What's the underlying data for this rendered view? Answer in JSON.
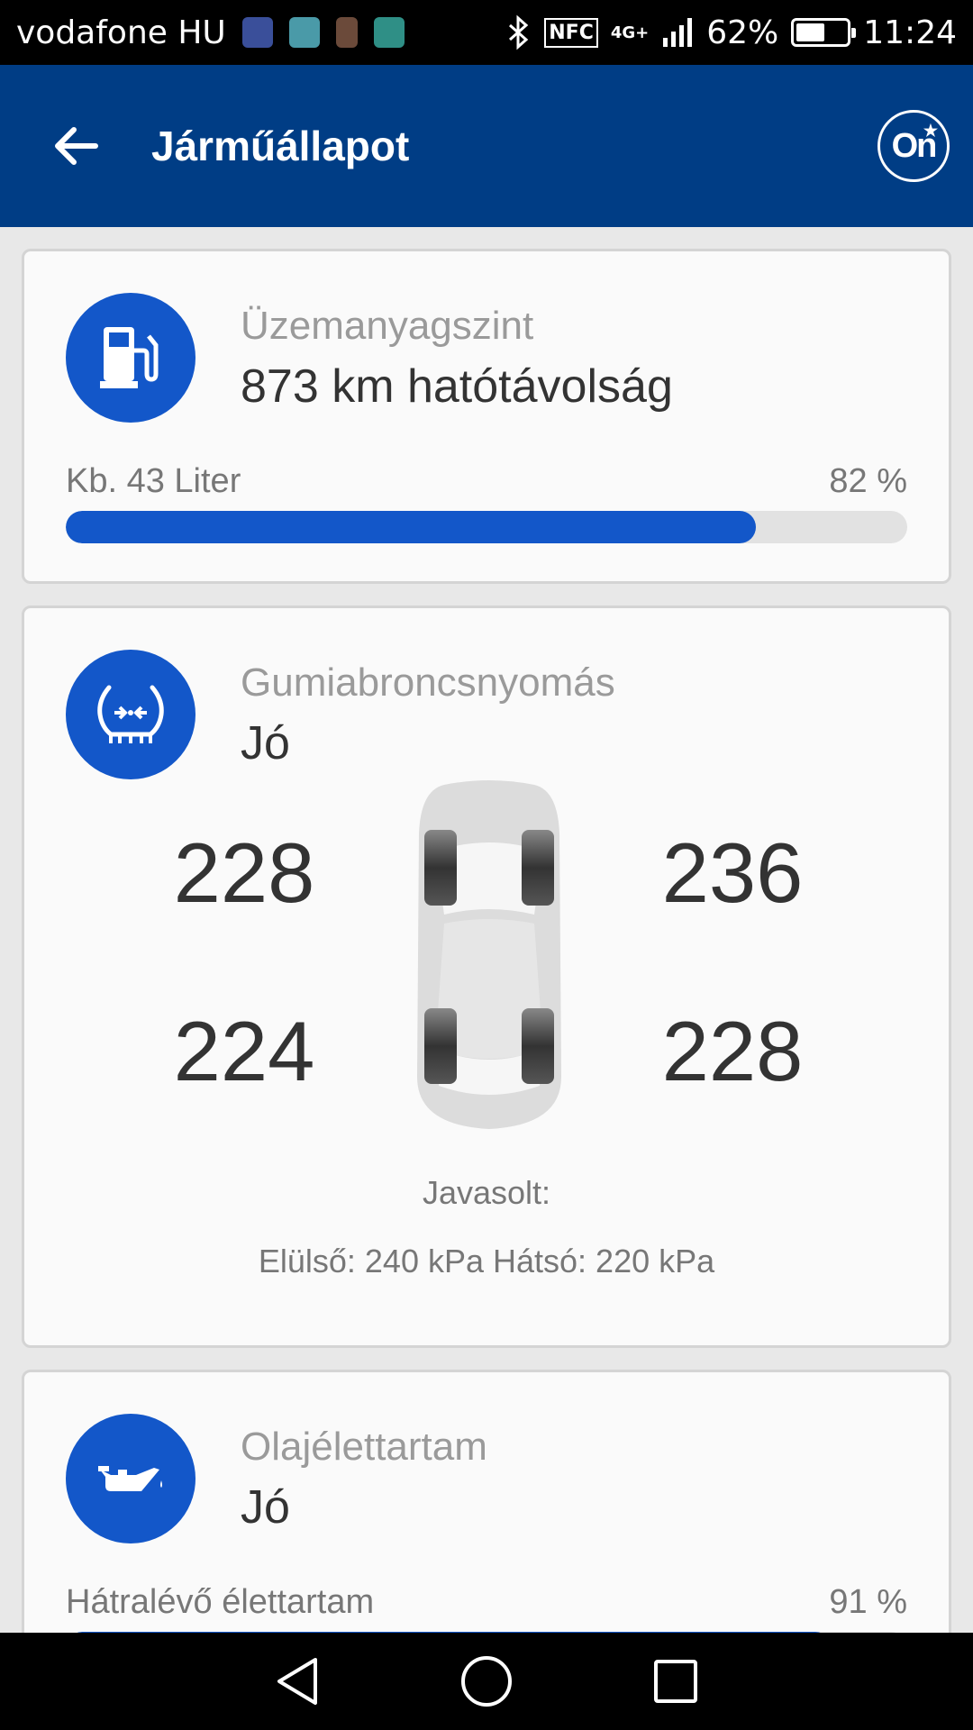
{
  "status_bar": {
    "carrier": "vodafone HU",
    "notification_icons": [
      "health-app-icon",
      "gallery-icon",
      "contact-photo-icon",
      "shield-app-icon"
    ],
    "nfc": "NFC",
    "network": "4G+",
    "battery_percent": "62%",
    "battery_level": 0.62,
    "time": "11:24"
  },
  "app_bar": {
    "title": "Járműállapot",
    "onstar_label": "On"
  },
  "fuel": {
    "icon": "fuel-pump-icon",
    "label": "Üzemanyagszint",
    "value": "873 km hatótávolság",
    "amount": "Kb. 43 Liter",
    "percent_text": "82 %",
    "percent": 82
  },
  "tires": {
    "icon": "tire-pressure-icon",
    "label": "Gumiabroncsnyomás",
    "status": "Jó",
    "front_left": "228",
    "front_right": "236",
    "rear_left": "224",
    "rear_right": "228",
    "recommended_label": "Javasolt:",
    "recommended_values": "Elülső: 240 kPa Hátsó: 220 kPa"
  },
  "oil": {
    "icon": "oil-can-icon",
    "label": "Olajélettartam",
    "status": "Jó",
    "remaining_label": "Hátralévő élettartam",
    "percent_text": "91 %",
    "percent": 91
  },
  "nav_bar": {
    "buttons": [
      "back-triangle-icon",
      "home-circle-icon",
      "recents-square-icon"
    ]
  },
  "colors": {
    "app_bar": "#003d85",
    "accent": "#1357c9",
    "card_bg": "#fafafa",
    "page_bg": "#e8e8e8"
  }
}
